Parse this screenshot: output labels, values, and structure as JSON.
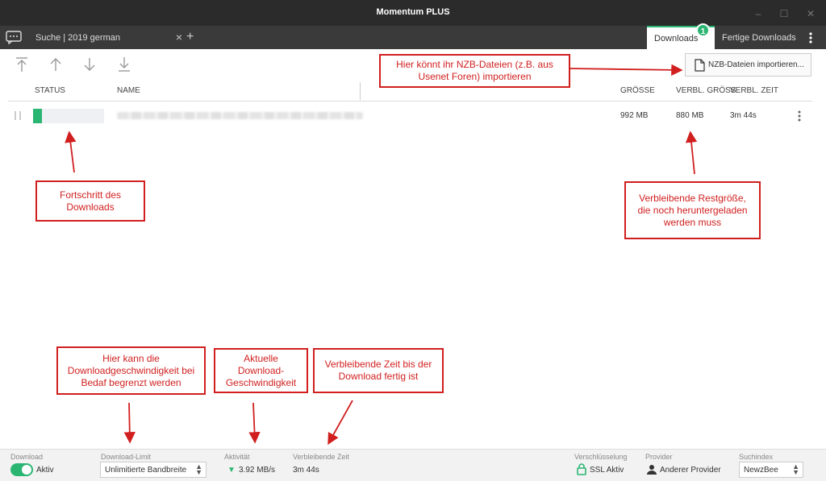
{
  "window": {
    "title": "Momentum PLUS"
  },
  "tabs": {
    "search_tab": "Suche | 2019 german",
    "close": "×",
    "add": "+"
  },
  "right_tabs": {
    "downloads": "Downloads",
    "downloads_badge": "1",
    "finished": "Fertige Downloads"
  },
  "toolbar": {
    "import_label": "NZB-Dateien importieren..."
  },
  "columns": {
    "status": "STATUS",
    "name": "NAME",
    "size": "GRÖSSE",
    "remaining_size": "VERBL. GRÖSS",
    "remaining_time": "VERBL. ZEIT"
  },
  "row": {
    "progress": 0.12,
    "size": "992 MB",
    "remaining_size": "880 MB",
    "remaining_time": "3m 44s"
  },
  "annotations": {
    "import": "Hier könnt ihr NZB-Dateien (z.B. aus Usenet Foren) importieren",
    "progress": "Fortschritt des Downloads",
    "remaining": "Verbleibende Restgröße, die noch heruntergeladen werden muss",
    "limit": "Hier kann die Downloadgeschwindigkeit bei Bedaf begrenzt werden",
    "speed": "Aktuelle Download-Geschwindigkeit",
    "time": "Verbleibende Zeit bis der Download fertig ist"
  },
  "status": {
    "download_label": "Download",
    "download_value": "Aktiv",
    "limit_label": "Download-Limit",
    "limit_value": "Unlimitierte Bandbreite",
    "activity_label": "Aktivität",
    "activity_value": "3.92 MB/s",
    "time_label": "Verbleibende Zeit",
    "time_value": "3m 44s",
    "encryption_label": "Verschlüsselung",
    "encryption_value": "SSL Aktiv",
    "provider_label": "Provider",
    "provider_value": "Anderer Provider",
    "index_label": "Suchindex",
    "index_value": "NewzBee"
  },
  "colors": {
    "accent": "#2bb573",
    "annotation": "#d11f1f"
  }
}
